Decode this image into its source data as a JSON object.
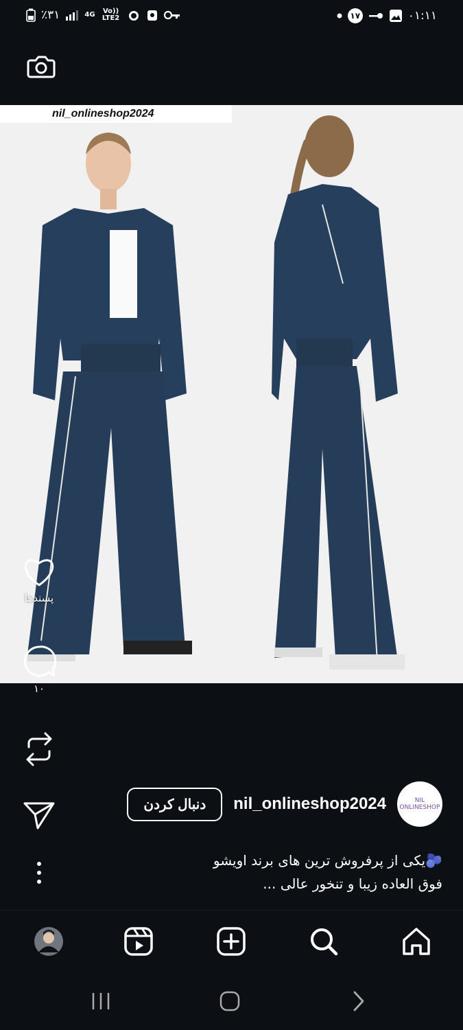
{
  "status_bar": {
    "battery": "٪۳۱",
    "network": "4G",
    "volte": "Vo)) LTE2",
    "time": "۰۱:۱۱",
    "notification_count": "۱۷"
  },
  "post": {
    "watermark": "nil_onlineshop2024",
    "likes_label": "پسندها",
    "comment_count": "۱۰"
  },
  "profile": {
    "username": "nil_onlineshop2024",
    "follow_label": "دنبال کردن",
    "avatar_text": "NIL ONLINESHOP"
  },
  "caption": {
    "line1": "🫐یکی از پرفروش ترین های برند اویشو",
    "line2": "فوق العاده زیبا و تنخور عالی ..."
  },
  "colors": {
    "background": "#0c1014",
    "accent": "#ffffff",
    "outfit": "#263f5c"
  }
}
